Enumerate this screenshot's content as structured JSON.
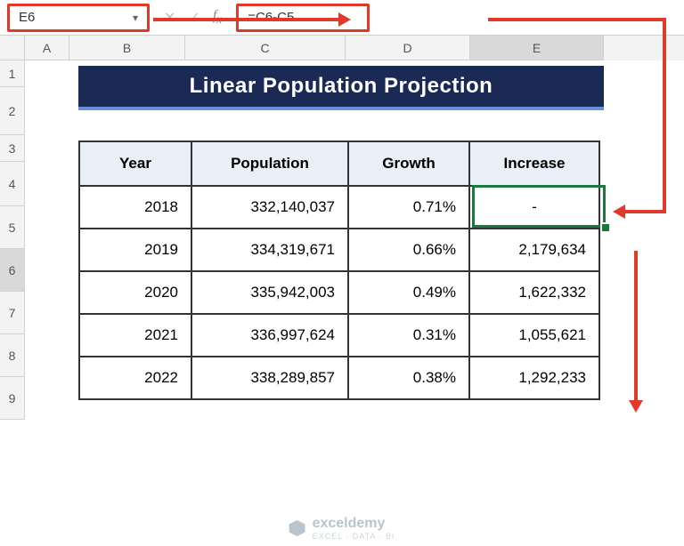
{
  "formula_bar": {
    "cell_ref": "E6",
    "formula": "=C6-C5"
  },
  "columns": [
    "A",
    "B",
    "C",
    "D",
    "E"
  ],
  "rows": [
    "1",
    "2",
    "3",
    "4",
    "5",
    "6",
    "7",
    "8",
    "9"
  ],
  "active_row": "6",
  "active_col": "E",
  "title": "Linear Population Projection",
  "headers": {
    "year": "Year",
    "population": "Population",
    "growth": "Growth",
    "increase": "Increase"
  },
  "data": [
    {
      "year": "2018",
      "population": "332,140,037",
      "growth": "0.71%",
      "increase": "-"
    },
    {
      "year": "2019",
      "population": "334,319,671",
      "growth": "0.66%",
      "increase": "2,179,634"
    },
    {
      "year": "2020",
      "population": "335,942,003",
      "growth": "0.49%",
      "increase": "1,622,332"
    },
    {
      "year": "2021",
      "population": "336,997,624",
      "growth": "0.31%",
      "increase": "1,055,621"
    },
    {
      "year": "2022",
      "population": "338,289,857",
      "growth": "0.38%",
      "increase": "1,292,233"
    }
  ],
  "watermark": {
    "brand": "exceldemy",
    "tag": "EXCEL · DATA · BI"
  }
}
